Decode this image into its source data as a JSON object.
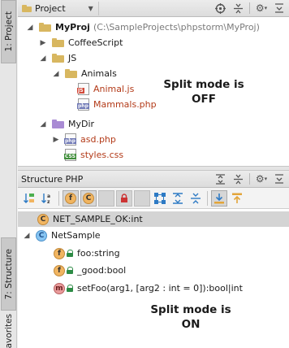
{
  "stripe": {
    "project_label": "1: Project",
    "structure_label": "7: Structure",
    "favorites_label": "avorites"
  },
  "project_panel": {
    "title": "Project",
    "tree": [
      {
        "label": "MyProj",
        "path": "(C:\\SampleProjects\\phpstorm\\MyProj)"
      },
      {
        "label": "CoffeeScript"
      },
      {
        "label": "JS"
      },
      {
        "label": "Animals"
      },
      {
        "label": "Animal.js"
      },
      {
        "label": "Mammals.php"
      },
      {
        "label": "MyDir"
      },
      {
        "label": "asd.php"
      },
      {
        "label": "styles.css"
      }
    ],
    "note_line1": "Split mode is",
    "note_line2": "OFF"
  },
  "structure_panel": {
    "title": "Structure PHP",
    "tree": [
      {
        "label": "NET_SAMPLE_OK:int"
      },
      {
        "label": "NetSample"
      },
      {
        "label": "foo:string"
      },
      {
        "label": "_good:bool"
      },
      {
        "label": "setFoo(arg1, [arg2 : int = 0]):bool|int"
      }
    ],
    "note_line1": "Split mode is",
    "note_line2": "ON"
  },
  "icons": {
    "file_js_tag": "JS",
    "file_php_tag": "php",
    "file_css_tag": "CSS",
    "field_letter": "f",
    "class_letter": "C",
    "method_letter": "m"
  },
  "colors": {
    "red_file_text": "#b33a18",
    "selected_row": "#d4d4d4"
  }
}
